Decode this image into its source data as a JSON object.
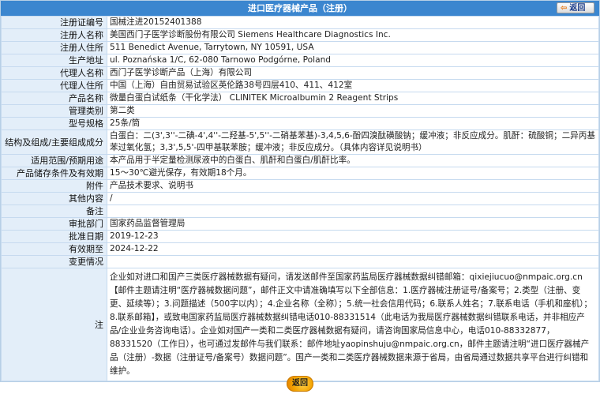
{
  "header": {
    "title": "进口医疗器械产品（注册）",
    "back_label": "返回"
  },
  "rows": [
    {
      "label": "注册证编号",
      "value": "国械注进20152401388"
    },
    {
      "label": "注册人名称",
      "value": "美国西门子医学诊断股份有限公司 Siemens Healthcare Diagnostics Inc."
    },
    {
      "label": "注册人住所",
      "value": "511 Benedict Avenue, Tarrytown, NY 10591, USA"
    },
    {
      "label": "生产地址",
      "value": "ul. Poznańska 1/C, 62-080 Tarnowo Podgórne, Poland"
    },
    {
      "label": "代理人名称",
      "value": "西门子医学诊断产品（上海）有限公司"
    },
    {
      "label": "代理人住所",
      "value": "中国（上海）自由贸易试验区英伦路38号四层410、411、412室"
    },
    {
      "label": "产品名称",
      "value": "微量白蛋白试纸条（干化学法） CLINITEK Microalbumin 2 Reagent Strips"
    },
    {
      "label": "管理类别",
      "value": "第二类"
    },
    {
      "label": "型号规格",
      "value": "25条/筒"
    },
    {
      "label": "结构及组成/主要组成成分",
      "value": "白蛋白：二(3',3''-二碘-4',4''-二羟基-5',5''-二硝基苯基)-3,4,5,6-酚四溴酞磺酸钠；缓冲液；非反应成分。肌酐：硫酸铜；二异丙基苯过氧化氢；3,3',5,5'-四甲基联苯胺；缓冲液；非反应成分。（具体内容详见说明书）"
    },
    {
      "label": "适用范围/预期用途",
      "value": "本产品用于半定量检测尿液中的白蛋白、肌酐和白蛋白/肌酐比率。"
    },
    {
      "label": "产品储存条件及有效期",
      "value": "15～30℃避光保存，有效期18个月。"
    },
    {
      "label": "附件",
      "value": "产品技术要求、说明书"
    },
    {
      "label": "其他内容",
      "value": "/"
    },
    {
      "label": "备注",
      "value": ""
    },
    {
      "label": "审批部门",
      "value": "国家药品监督管理局"
    },
    {
      "label": "批准日期",
      "value": "2019-12-23"
    },
    {
      "label": "有效期至",
      "value": "2024-12-22"
    },
    {
      "label": "变更情况",
      "value": ""
    }
  ],
  "note": {
    "label": "注",
    "text": "企业如对进口和国产三类医疗器械数据有疑问，请发送邮件至国家药监局医疗器械数据纠错邮箱：qixiejiucuo@nmpaic.org.cn【邮件主题请注明“医疗器械数据问题”，邮件正文中请准确填写以下全部信息：1.医疗器械注册证号/备案号；2.类型（注册、变更、延续等）；3.问题描述（500字以内）；4.企业名称（全称）；5.统一社会信用代码；6.联系人姓名；7.联系电话（手机和座机）；8.联系邮箱】，或致电国家药监局医疗器械数据纠错电话010-88331514（此电话为我局医疗器械数据纠错联系电话，并非相应产品/企业业务咨询电话）。企业如对国产一类和二类医疗器械数据有疑问，请咨询国家局信息中心，电话010-88332877，88331520（工作日），也可通过发邮件与我们联系：邮件地址yaopinshuju@nmpaic.org.cn，邮件主题请注明“进口医疗器械产品（注册）-数据（注册证号/备案号）数据问题”。国产一类和二类医疗器械数据来源于省局，由省局通过数据共享平台进行纠错和维护。"
  },
  "footer": {
    "back_label": "返回"
  }
}
